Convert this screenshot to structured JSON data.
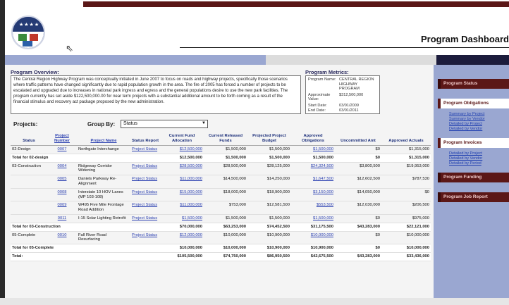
{
  "header": {
    "page_title": "Program Dashboard"
  },
  "overview": {
    "title": "Program Overview:",
    "text": "The Central Region Highway Program was conceptually initiated in June 2007 to focus on roads and highway projects, specifically those scenarios where traffic patterns have changed significantly due to rapid population growth in the area. The fire of 2005 has forced a number of projects to be escalated and upgraded due to increases in national park ingress and egress and the general populations desire to use the new park facilities. The program currently has set aside $122,500,000.00 for near term projects with a substantial additional amount to be forth coming as a result of the financial stimulus and recovery act package proposed by the new administration."
  },
  "metrics": {
    "title": "Program Metrics:",
    "rows": [
      {
        "k": "Program Name:",
        "v": "CENTRAL REGION HIGHWAY PROGRAM"
      },
      {
        "k": "Approximate Value:",
        "v": "$312,500,000"
      },
      {
        "k": "Start Date:",
        "v": "03/01/2009"
      },
      {
        "k": "End Date:",
        "v": "03/01/2011"
      }
    ]
  },
  "controls": {
    "projects_label": "Projects:",
    "groupby_label": "Group By:",
    "groupby_value": "Status"
  },
  "table": {
    "headers": [
      "Status",
      "Project Number",
      "Project Name",
      "Status Report",
      "Current Fund Allocation",
      "Current Released Funds",
      "Projected Project Budget",
      "Approved Obligations",
      "Uncommitted Amt",
      "Approved Actuals"
    ],
    "rows": [
      {
        "status": "02-Design",
        "num": "0007",
        "name": "Northgate Interchange",
        "report": "Project Status",
        "alloc": "$12,500,000",
        "released": "$1,500,000",
        "budget": "$1,500,000",
        "oblig": "$1,500,000",
        "uncommitted": "$0",
        "actuals": "$1,315,000"
      },
      {
        "total": "Total for 02-design",
        "alloc": "$12,500,000",
        "released": "$1,500,000",
        "budget": "$1,500,000",
        "oblig": "$1,500,000",
        "uncommitted": "$0",
        "actuals": "$1,315,000"
      },
      {
        "status": "03-Construction",
        "num": "0004",
        "name": "Ridgeway Corridor Widening",
        "report": "Project Status",
        "alloc": "$28,500,000",
        "released": "$28,500,000",
        "budget": "$28,125,000",
        "oblig": "$24,324,500",
        "uncommitted": "$3,800,500",
        "actuals": "$19,953,000"
      },
      {
        "status": "",
        "num": "0005",
        "name": "Daniels Parkway Re-Alignment",
        "report": "Project Status",
        "alloc": "$11,000,000",
        "released": "$14,500,000",
        "budget": "$14,250,000",
        "oblig": "$1,647,500",
        "uncommitted": "$12,602,500",
        "actuals": "$787,530"
      },
      {
        "status": "",
        "num": "0008",
        "name": "Interstate 10 HOV Lanes (MP 103-108)",
        "report": "Project Status",
        "alloc": "$15,000,000",
        "released": "$18,000,000",
        "budget": "$18,900,000",
        "oblig": "$3,150,000",
        "uncommitted": "$14,050,000",
        "actuals": "$0"
      },
      {
        "status": "",
        "num": "0009",
        "name": "W495 Five Mile Frontage Road Addition",
        "report": "Project Status",
        "alloc": "$11,000,000",
        "released": "$753,000",
        "budget": "$12,581,500",
        "oblig": "$553,500",
        "uncommitted": "$12,030,000",
        "actuals": "$206,500"
      },
      {
        "status": "",
        "num": "0011",
        "name": "I-15 Solar Lighting Retrofit",
        "report": "Project Status",
        "alloc": "$1,500,000",
        "released": "$1,500,000",
        "budget": "$1,500,000",
        "oblig": "$1,500,000",
        "uncommitted": "$0",
        "actuals": "$975,000"
      },
      {
        "total": "Total for 03-Construction",
        "alloc": "$70,000,000",
        "released": "$63,253,000",
        "budget": "$74,452,500",
        "oblig": "$31,175,500",
        "uncommitted": "$43,283,000",
        "actuals": "$22,121,000"
      },
      {
        "status": "05-Complete",
        "num": "0010",
        "name": "Fall River Road Resurfacing",
        "report": "Project Status",
        "alloc": "$12,000,000",
        "released": "$10,000,000",
        "budget": "$10,900,000",
        "oblig": "$10,000,000",
        "uncommitted": "$0",
        "actuals": "$10,000,000"
      },
      {
        "total": "Total for 05-Complete",
        "alloc": "$10,000,000",
        "released": "$10,000,000",
        "budget": "$10,900,000",
        "oblig": "$10,900,000",
        "uncommitted": "$0",
        "actuals": "$10,000,000"
      },
      {
        "total": "Total:",
        "alloc": "$105,500,000",
        "released": "$74,750,000",
        "budget": "$86,950,500",
        "oblig": "$42,675,500",
        "uncommitted": "$43,283,000",
        "actuals": "$33,436,000"
      }
    ]
  },
  "sidebar": {
    "items": [
      {
        "label": "Program Status",
        "active": false
      },
      {
        "label": "Program Obligations",
        "active": true,
        "subs": [
          "Summary by Project",
          "Summary by Vendor",
          "Detailed by Project",
          "Detailed by Vendor"
        ]
      },
      {
        "label": "Program Invoices",
        "active": true,
        "subs": [
          "Detailed by Project",
          "Detailed by Vendor",
          "Detailed by Period"
        ]
      },
      {
        "label": "Program Funding",
        "active": false
      },
      {
        "label": "Program Job Report",
        "active": false
      }
    ]
  }
}
